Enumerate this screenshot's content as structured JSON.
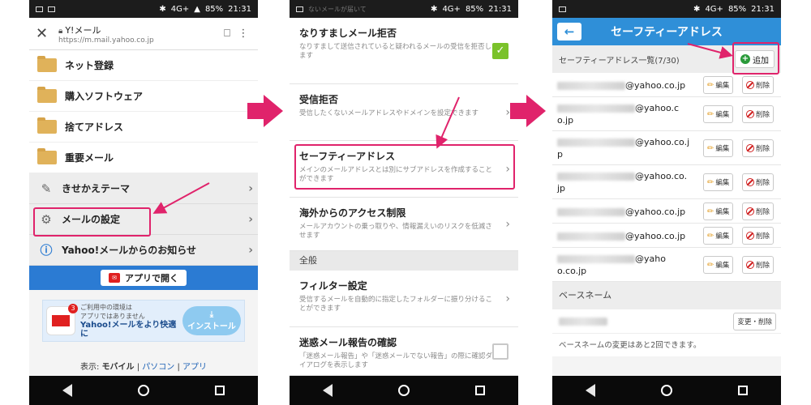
{
  "status": {
    "network": "4G+",
    "battery": "85%",
    "time": "21:31"
  },
  "panel1": {
    "url_title": "Y!メール",
    "url": "https://m.mail.yahoo.co.jp",
    "folders": [
      "ネット登録",
      "購入ソフトウェア",
      "捨てアドレス",
      "重要メール"
    ],
    "menu": [
      {
        "label": "きせかえテーマ"
      },
      {
        "label": "メールの設定"
      },
      {
        "label": "Yahoo!メールからのお知らせ"
      }
    ],
    "app_button": "アプリで開く",
    "yahoo_mini": "YAHOO!",
    "banner": {
      "badge": "3",
      "line1": "ご利用中の環境は",
      "line2": "アプリではありません",
      "line3": "Yahoo!メールをより快適に",
      "install": "インストール"
    },
    "footer": {
      "prefix": "表示:",
      "mobile": "モバイル",
      "sep": "|",
      "pc": "パソコン",
      "app": "アプリ"
    }
  },
  "panel2": {
    "cut_desc": "ないメールが届いて",
    "rows": [
      {
        "title": "なりすましメール拒否",
        "desc": "なりすまして送信されていると疑われるメールの受信を拒否します",
        "control": "checkbox-on"
      },
      {
        "title": "受信拒否",
        "desc": "受信したくないメールアドレスやドメインを設定できます",
        "control": "chevron"
      },
      {
        "title": "セーフティーアドレス",
        "desc": "メインのメールアドレスとは別にサブアドレスを作成することができます",
        "control": "chevron"
      },
      {
        "title": "海外からのアクセス制限",
        "desc": "メールアカウントの乗っ取りや、情報漏えいのリスクを低減させます",
        "control": "chevron"
      }
    ],
    "section": "全般",
    "rows2": [
      {
        "title": "フィルター設定",
        "desc": "受信するメールを自動的に指定したフォルダーに振り分けることができます",
        "control": "chevron"
      },
      {
        "title": "迷惑メール報告の確認",
        "desc": "「迷惑メール報告」や「迷惑メールでない報告」の際に確認ダイアログを表示します",
        "control": "checkbox-off"
      }
    ]
  },
  "panel3": {
    "title": "セーフティーアドレス",
    "list_label": "セーフティーアドレス一覧(7/30)",
    "add": "追加",
    "edit": "編集",
    "delete": "削除",
    "addresses": [
      {
        "line1": "@yahoo.co.jp",
        "line2": ""
      },
      {
        "line1": "@yahoo.c",
        "line2": "o.jp"
      },
      {
        "line1": "@yahoo.co.j",
        "line2": "p"
      },
      {
        "line1": "@yahoo.co.",
        "line2": "jp"
      },
      {
        "line1": "@yahoo.co.jp",
        "line2": ""
      },
      {
        "line1": "@yahoo.co.jp",
        "line2": ""
      },
      {
        "line1": "@yaho",
        "line2": "o.co.jp"
      }
    ],
    "basename_label": "ベースネーム",
    "change": "変更・削除",
    "basename_note": "ベースネームの変更はあと2回できます。"
  }
}
